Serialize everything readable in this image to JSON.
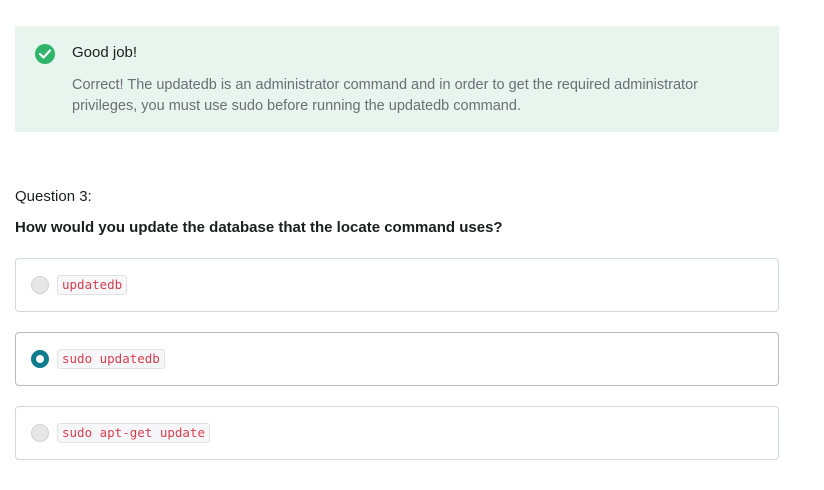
{
  "feedback": {
    "icon": "check-circle-icon",
    "color": "#2fb46a",
    "title": "Good job!",
    "body": "Correct! The updatedb is an administrator command and in order to get the required administrator privileges, you must use sudo before running the updatedb command."
  },
  "question": {
    "number_label": "Question 3:",
    "text": "How would you update the database that the locate command uses?"
  },
  "options": [
    {
      "code": "updatedb",
      "selected": false
    },
    {
      "code": "sudo updatedb",
      "selected": true
    },
    {
      "code": "sudo apt-get update",
      "selected": false
    }
  ],
  "colors": {
    "accent_radio": "#0f7c90",
    "feedback_bg": "#e8f5ee",
    "code_text": "#d63e4f"
  }
}
